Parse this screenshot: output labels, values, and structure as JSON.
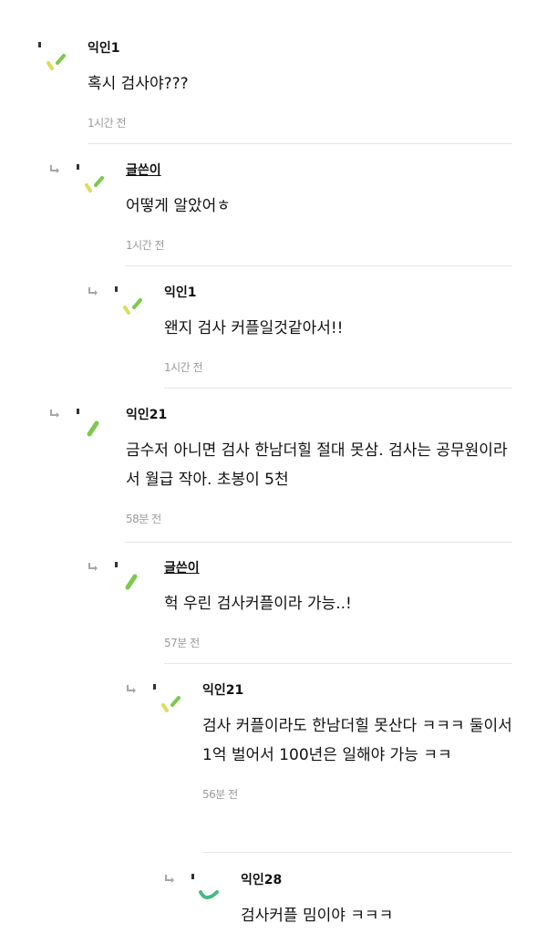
{
  "comments": [
    {
      "author": "익인1",
      "text": "혹시 검사야???",
      "time": "1시간 전",
      "avatar_style": "yellow-green"
    },
    {
      "author": "글쓴이",
      "text": "어떻게 알았어ㅎ",
      "time": "1시간 전",
      "avatar_style": "yellow-green"
    },
    {
      "author": "익인1",
      "text": "왠지 검사 커플일것같아서!!",
      "time": "1시간 전",
      "avatar_style": "yellow-green"
    },
    {
      "author": "익인21",
      "text": "금수저 아니면 검사 한남더힐 절대 못삼. 검사는 공무원이라서 월급 작아. 초봉이 5천",
      "time": "58분 전",
      "avatar_style": "green"
    },
    {
      "author": "글쓴이",
      "text": "헉 우린 검사커플이라 가능..!",
      "time": "57분 전",
      "avatar_style": "green"
    },
    {
      "author": "익인21",
      "text": "검사 커플이라도 한남더힐 못산다 ㅋㅋㅋ 둘이서 1억 벌어서 100년은 일해야 가능 ㅋㅋ",
      "time": "56분 전",
      "avatar_style": "yellow-green"
    },
    {
      "author": "익인28",
      "text": "검사커플 밈이야 ㅋㅋㅋ",
      "time": "",
      "avatar_style": "teal-curve"
    }
  ],
  "colors": {
    "yellow": "#d9df5a",
    "green": "#7cc94d",
    "teal": "#49b887",
    "arrow": "#a6a6a6"
  }
}
